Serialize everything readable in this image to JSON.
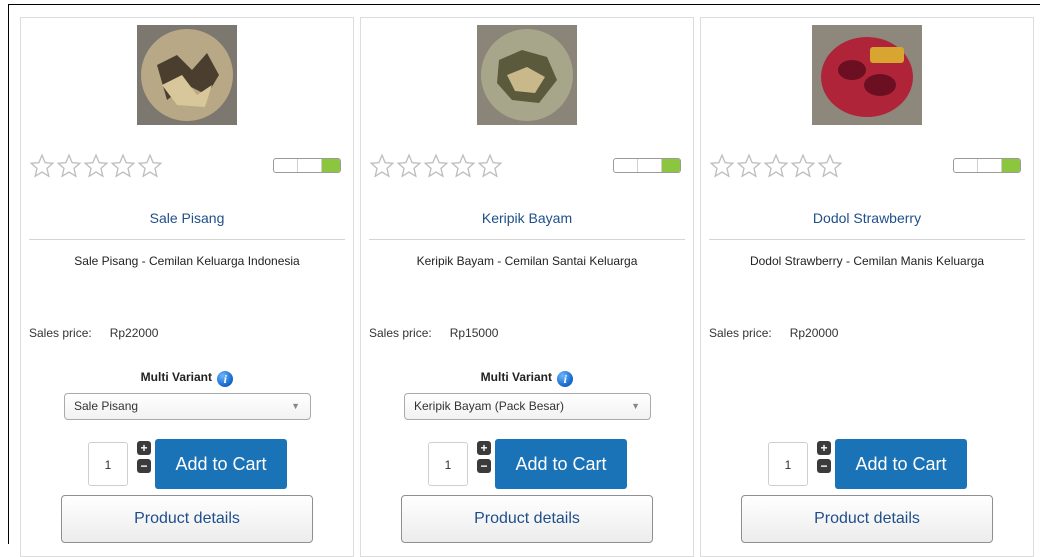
{
  "products": [
    {
      "name": "Sale Pisang",
      "description": "Sale Pisang - Cemilan Keluarga Indonesia",
      "price_label": "Sales price:",
      "price": "Rp22000",
      "has_variant": true,
      "variant_label": "Multi Variant",
      "variant_selected": "Sale Pisang",
      "quantity": "1",
      "add_to_cart_label": "Add to Cart",
      "details_label": "Product details",
      "rating_stars": 0,
      "thumb_colors": [
        "#7c776f",
        "#b8a886",
        "#4a3f2e"
      ]
    },
    {
      "name": "Keripik Bayam",
      "description": "Keripik Bayam - Cemilan Santai Keluarga",
      "price_label": "Sales price:",
      "price": "Rp15000",
      "has_variant": true,
      "variant_label": "Multi Variant",
      "variant_selected": "Keripik Bayam (Pack Besar)",
      "quantity": "1",
      "add_to_cart_label": "Add to Cart",
      "details_label": "Product details",
      "rating_stars": 0,
      "thumb_colors": [
        "#8a8479",
        "#a7a58a",
        "#5c5a3c"
      ]
    },
    {
      "name": "Dodol Strawberry",
      "description": "Dodol Strawberry - Cemilan Manis Keluarga",
      "price_label": "Sales price:",
      "price": "Rp20000",
      "has_variant": false,
      "quantity": "1",
      "add_to_cart_label": "Add to Cart",
      "details_label": "Product details",
      "rating_stars": 0,
      "thumb_colors": [
        "#8d877c",
        "#b0243a",
        "#6d0f22"
      ]
    }
  ],
  "info_icon_glyph": "i",
  "stepper": {
    "plus": "+",
    "minus": "−"
  },
  "colors": {
    "link_blue": "#1f4f8a",
    "cart_button": "#1a73b6",
    "toggle_on": "#8cc63f"
  }
}
